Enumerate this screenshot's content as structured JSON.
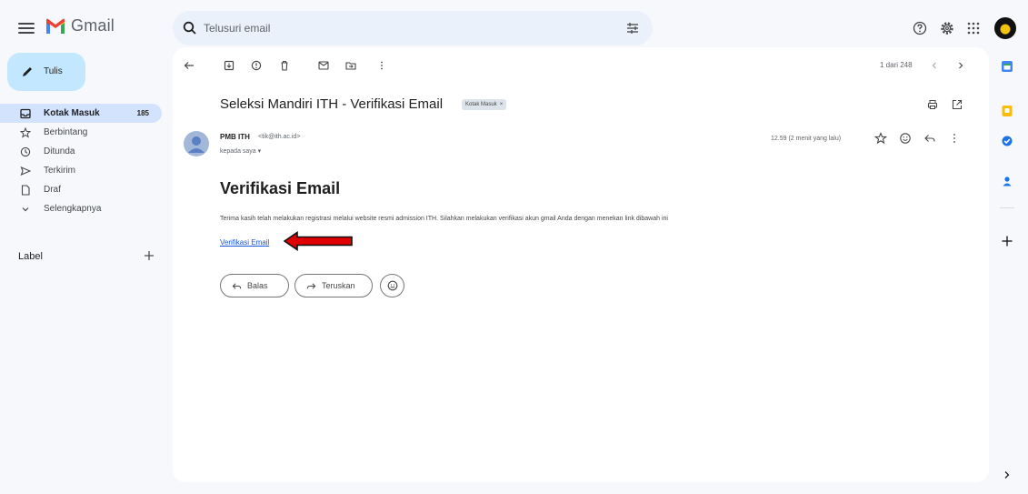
{
  "app": {
    "name": "Gmail"
  },
  "search": {
    "placeholder": "Telusuri email"
  },
  "compose": {
    "label": "Tulis"
  },
  "nav": {
    "items": [
      {
        "label": "Kotak Masuk",
        "count": "185",
        "icon": "inbox-icon",
        "active": true
      },
      {
        "label": "Berbintang",
        "icon": "star-icon"
      },
      {
        "label": "Ditunda",
        "icon": "clock-icon"
      },
      {
        "label": "Terkirim",
        "icon": "send-icon"
      },
      {
        "label": "Draf",
        "icon": "draft-icon"
      },
      {
        "label": "Selengkapnya",
        "icon": "chevron-down-icon"
      }
    ],
    "label_header": "Label"
  },
  "toolbar": {
    "pager": "1 dari 248"
  },
  "email": {
    "subject": "Seleksi Mandiri ITH - Verifikasi Email",
    "label_chip": "Kotak Masuk",
    "label_chip_close": "×",
    "sender_name": "PMB ITH",
    "sender_email": "<tik@ith.ac.id>",
    "recipient": "kepada saya ▾",
    "timestamp": "12.59 (2 menit yang lalu)",
    "body_title": "Verifikasi Email",
    "body_text": "Terima kasih telah melakukan registrasi melalui website resmi admission ITH. Silahkan melakukan verifikasi akun gmail Anda dengan menekan link dibawah ini",
    "link_text": "Verifikasi Email"
  },
  "actions": {
    "reply": "Balas",
    "forward": "Teruskan"
  },
  "colors": {
    "accent_red": "#e00000",
    "compose_bg": "#c2e7ff",
    "active_nav": "#d3e3fd",
    "link": "#1a56db"
  }
}
